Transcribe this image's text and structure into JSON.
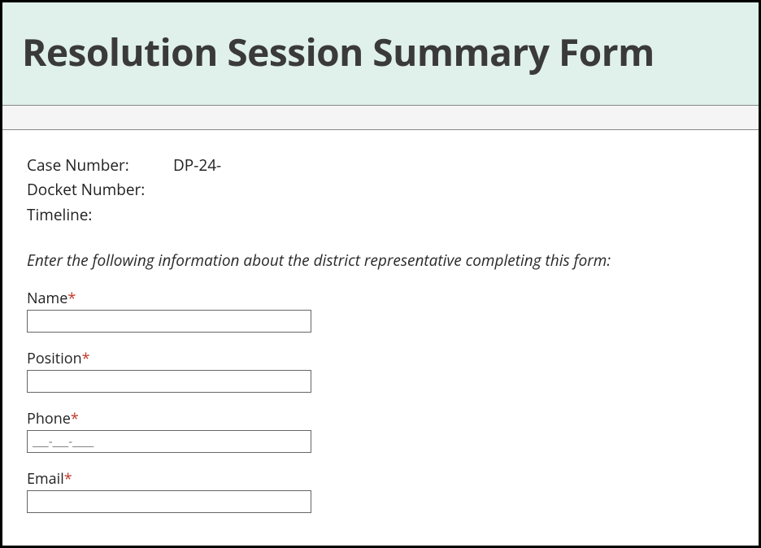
{
  "header": {
    "title": "Resolution Session Summary Form"
  },
  "info": {
    "case_number_label": "Case Number:",
    "case_number_value": "DP-24-",
    "docket_number_label": "Docket Number:",
    "docket_number_value": "",
    "timeline_label": "Timeline:",
    "timeline_value": ""
  },
  "instruction": "Enter the following information about the district representative completing this form:",
  "fields": {
    "name": {
      "label": "Name",
      "value": ""
    },
    "position": {
      "label": "Position",
      "value": ""
    },
    "phone": {
      "label": "Phone",
      "value": "",
      "placeholder": "___-___-____"
    },
    "email": {
      "label": "Email",
      "value": ""
    }
  },
  "required_marker": "*"
}
